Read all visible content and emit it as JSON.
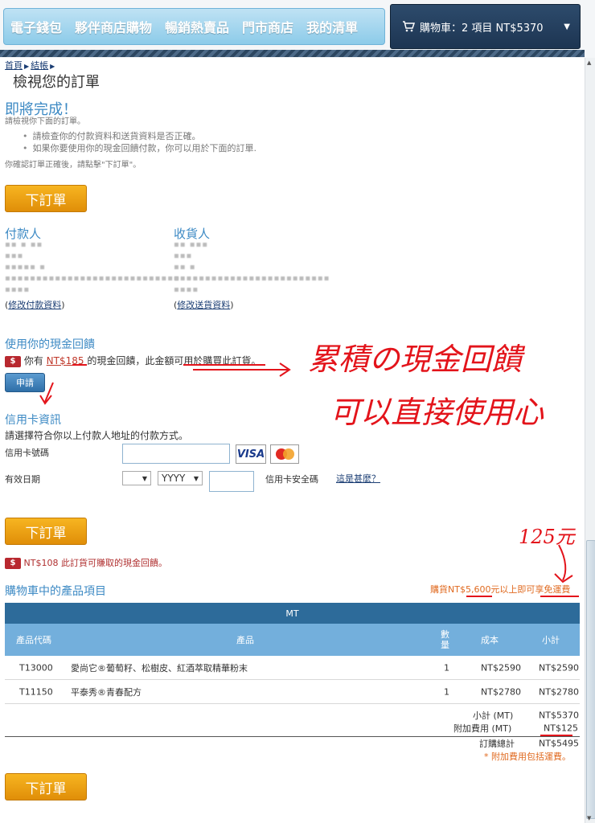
{
  "nav": {
    "items": [
      "電子錢包",
      "夥伴商店購物",
      "暢銷熱賣品",
      "門市商店",
      "我的清單"
    ]
  },
  "cart": {
    "label": "購物車：2 項目 NT$5370"
  },
  "breadcrumb": {
    "home": "首頁",
    "checkout": "結帳"
  },
  "page": {
    "title": "檢視您的訂單",
    "almost_done": "即將完成！",
    "review_hint": "請檢視你下面的訂單。",
    "bullets": [
      "請檢查你的付款資料和送貨資料是否正確。",
      "如果你要使用你的現金回饋付款，你可以用於下面的訂單."
    ],
    "confirm_hint": "你確認訂單正確後，請點擊\"下訂單\"。",
    "place_order": "下訂單"
  },
  "payer": {
    "heading": "付款人",
    "edit_link": "修改付款資料"
  },
  "recipient": {
    "heading": "收貨人",
    "edit_link": "修改送貨資料"
  },
  "cashback": {
    "heading": "使用你的現金回饋",
    "text_before": "你有",
    "amount": "NT$185",
    "text_after": "的現金回饋，此金額可用於購買此訂貨。",
    "apply": "申請",
    "earn_text": "NT$108 此訂貨可賺取的現金回饋。",
    "icon": "cash-icon"
  },
  "card": {
    "heading": "信用卡資訊",
    "instruction": "請選擇符合你以上付款人地址的付款方式。",
    "number_label": "信用卡號碼",
    "expiry_label": "有效日期",
    "month_value": "",
    "year_value": "YYYY",
    "cvv_label": "信用卡安全碼",
    "whats_this": "這是甚麼？",
    "visa": "VISA"
  },
  "cart_items": {
    "heading": "購物車中的產品項目",
    "free_shipping": "購貨NT$5,600元以上即可享免運費",
    "table_title": "MT",
    "headers": {
      "code": "產品代碼",
      "product": "產品",
      "qty": "數量",
      "cost": "成本",
      "subtotal": "小計"
    },
    "rows": [
      {
        "code": "T13000",
        "product": "愛尚它®葡萄籽、松樹皮、紅酒萃取精華粉末",
        "qty": "1",
        "cost": "NT$2590",
        "subtotal": "NT$2590"
      },
      {
        "code": "T11150",
        "product": "平泰秀®青春配方",
        "qty": "1",
        "cost": "NT$2780",
        "subtotal": "NT$2780"
      }
    ],
    "summary": {
      "subtotal_label": "小計 (MT)",
      "subtotal_value": "NT$5370",
      "fee_label": "附加費用 (MT)",
      "fee_value": "NT$125",
      "total_label": "訂購總計",
      "total_value": "NT$5495",
      "fee_note": "* 附加費用包括運費。"
    }
  },
  "annotations": {
    "line1": "累積の現金回饋",
    "line2": "可以直接使用心",
    "fee_note": "125元"
  }
}
